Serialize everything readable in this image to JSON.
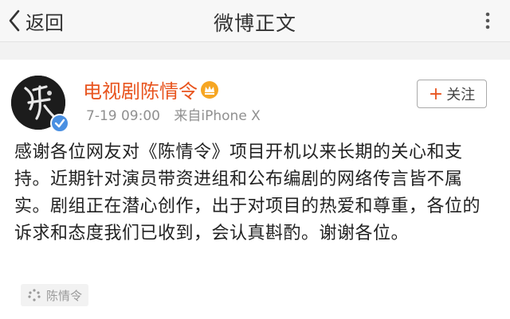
{
  "navbar": {
    "back_label": "返回",
    "title": "微博正文",
    "back_icon": "chevron-left-icon",
    "more_icon": "more-dots-icon"
  },
  "post": {
    "author": "电视剧陈情令",
    "timestamp": "7-19 09:00",
    "source": "来自iPhone X",
    "follow_label": "关注",
    "text": "感谢各位网友对《陈情令》项目开机以来长期的关心和支持。近期针对演员带资进组和公布编剧的网络传言皆不属实。剧组正在潜心创作，出于对项目的热爱和尊重，各位的诉求和态度我们已收到，会认真斟酌。谢谢各位。",
    "topic_label": "陈情令"
  },
  "colors": {
    "author": "#e8541e",
    "verified": "#4a90e2",
    "meta": "#909090"
  }
}
